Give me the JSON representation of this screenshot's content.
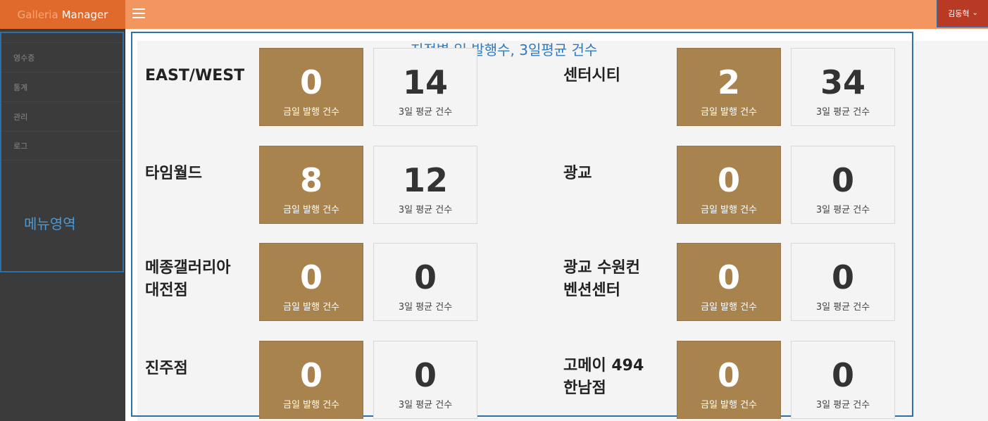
{
  "header": {
    "brand_accent": "Galleria",
    "brand_text": "Manager",
    "user_name": "김동혁"
  },
  "sidebar": {
    "items": [
      {
        "label": "영수증"
      },
      {
        "label": "통계"
      },
      {
        "label": "관리"
      },
      {
        "label": "로그"
      }
    ],
    "area_label": "메뉴영역"
  },
  "main": {
    "title": "지점별 일 발행수, 3일평균 건수",
    "today_caption": "금일 발행 건수",
    "avg_caption": "3일 평균 건수",
    "branches": [
      {
        "name": "EAST/WEST",
        "today": "0",
        "avg": "14"
      },
      {
        "name": "센터시티",
        "today": "2",
        "avg": "34"
      },
      {
        "name": "타임월드",
        "today": "8",
        "avg": "12"
      },
      {
        "name": "광교",
        "today": "0",
        "avg": "0"
      },
      {
        "name": "메종갤러리아\n대전점",
        "today": "0",
        "avg": "0"
      },
      {
        "name": "광교 수원컨\n벤션센터",
        "today": "0",
        "avg": "0"
      },
      {
        "name": "진주점",
        "today": "0",
        "avg": "0"
      },
      {
        "name": "고메이 494\n한남점",
        "today": "0",
        "avg": "0"
      }
    ]
  },
  "colors": {
    "brand": "#e06a2c",
    "topbar": "#f2955f",
    "user_menu": "#b93a24",
    "sidebar": "#3b3b3b",
    "tile_today": "#a8834e",
    "annotation": "#2f6fa6"
  }
}
